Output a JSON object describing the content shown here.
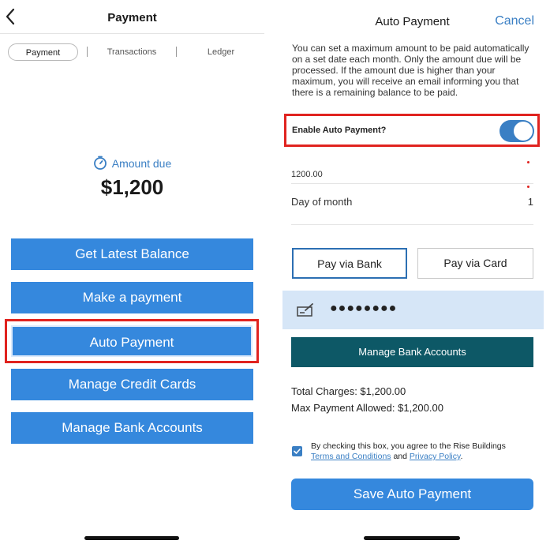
{
  "left": {
    "header": {
      "title": "Payment"
    },
    "tabs": [
      {
        "label": "Payment",
        "active": true
      },
      {
        "label": "Transactions",
        "active": false
      },
      {
        "label": "Ledger",
        "active": false
      }
    ],
    "amount_due": {
      "label": "Amount due",
      "value": "$1,200"
    },
    "buttons": {
      "latest_balance": "Get Latest Balance",
      "make_payment": "Make a payment",
      "auto_payment": "Auto Payment",
      "credit_cards": "Manage Credit Cards",
      "bank_accounts": "Manage Bank Accounts"
    }
  },
  "right": {
    "header": {
      "title": "Auto Payment",
      "cancel": "Cancel"
    },
    "description": "You can set a maximum amount to be paid automatically on a set date each month. Only the amount due will be processed. If the amount due is higher than your maximum, you will receive an email informing you that there is a remaining balance to be paid.",
    "toggle": {
      "label": "Enable Auto Payment?",
      "enabled": true
    },
    "max_amount_value": "1200.00",
    "day_of_month": {
      "label": "Day of month",
      "value": "1"
    },
    "pay_options": {
      "bank": "Pay via Bank",
      "card": "Pay via Card",
      "selected": "bank"
    },
    "account_mask": "●●●●●●●●",
    "manage_bank_button": "Manage Bank Accounts",
    "total_charges": "Total Charges: $1,200.00",
    "max_payment": "Max Payment Allowed: $1,200.00",
    "agreement": {
      "checked": true,
      "prefix": "By checking this box, you agree to the Rise Buildings",
      "terms": "Terms and Conditions",
      "and": " and ",
      "privacy": "Privacy Policy",
      "suffix": "."
    },
    "save_button": "Save Auto Payment"
  },
  "colors": {
    "primary_blue": "#3588dd",
    "link_blue": "#3a7fc4",
    "teal": "#0d5866",
    "highlight_red": "#e0231f",
    "account_row_bg": "#d6e6f7"
  }
}
